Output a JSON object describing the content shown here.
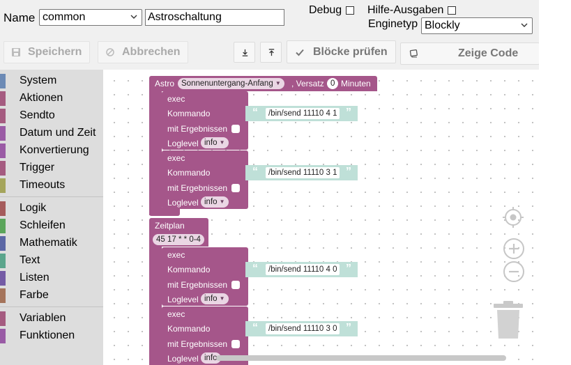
{
  "header": {
    "name_label": "Name",
    "name_value": "common",
    "title_value": "Astroschaltung",
    "debug_label": "Debug",
    "debug_checked": false,
    "hilfe_label": "Hilfe-Ausgaben",
    "hilfe_checked": false,
    "enginetype_label": "Enginetyp",
    "enginetype_value": "Blockly"
  },
  "toolbar": {
    "save_label": "Speichern",
    "cancel_label": "Abbrechen",
    "check_label": "Blöcke prüfen",
    "code_label": "Zeige Code"
  },
  "toolbox": {
    "groups": [
      [
        {
          "label": "System",
          "color": "#6c8ab5"
        },
        {
          "label": "Aktionen",
          "color": "#a55b80"
        },
        {
          "label": "Sendto",
          "color": "#a55b80"
        },
        {
          "label": "Datum und Zeit",
          "color": "#9a5ba5"
        },
        {
          "label": "Konvertierung",
          "color": "#9a5ba5"
        },
        {
          "label": "Trigger",
          "color": "#a55b80"
        },
        {
          "label": "Timeouts",
          "color": "#a5a55b"
        }
      ],
      [
        {
          "label": "Logik",
          "color": "#a55b5b"
        },
        {
          "label": "Schleifen",
          "color": "#5ba55b"
        },
        {
          "label": "Mathematik",
          "color": "#5b67a5"
        },
        {
          "label": "Text",
          "color": "#5ba58c"
        },
        {
          "label": "Listen",
          "color": "#745ba5"
        },
        {
          "label": "Farbe",
          "color": "#a5745b"
        }
      ],
      [
        {
          "label": "Variablen",
          "color": "#a55b80"
        },
        {
          "label": "Funktionen",
          "color": "#995ba5"
        }
      ]
    ]
  },
  "blocks": {
    "astro": {
      "label": "Astro",
      "event": "Sonnenuntergang-Anfang",
      "offset_label": ", Versatz",
      "offset_value": "0",
      "unit": "Minuten"
    },
    "zeitplan": {
      "label": "Zeitplan",
      "cron": "45 17 * * 0-4"
    },
    "exec_label": "exec",
    "command_label": "Kommando",
    "result_label": "mit Ergebnissen",
    "loglevel_label": "Loglevel",
    "loglevel_value": "info",
    "commands": [
      "/bin/send 11110 4 1",
      "/bin/send 11110 3 1",
      "/bin/send 11110 4 0",
      "/bin/send 11110 3 0"
    ],
    "last_loglevel_visible": "info"
  },
  "colors": {
    "event_block": "#a5568a",
    "text_block": "#bfe0d8",
    "toolbox_bg": "#dddddd"
  }
}
